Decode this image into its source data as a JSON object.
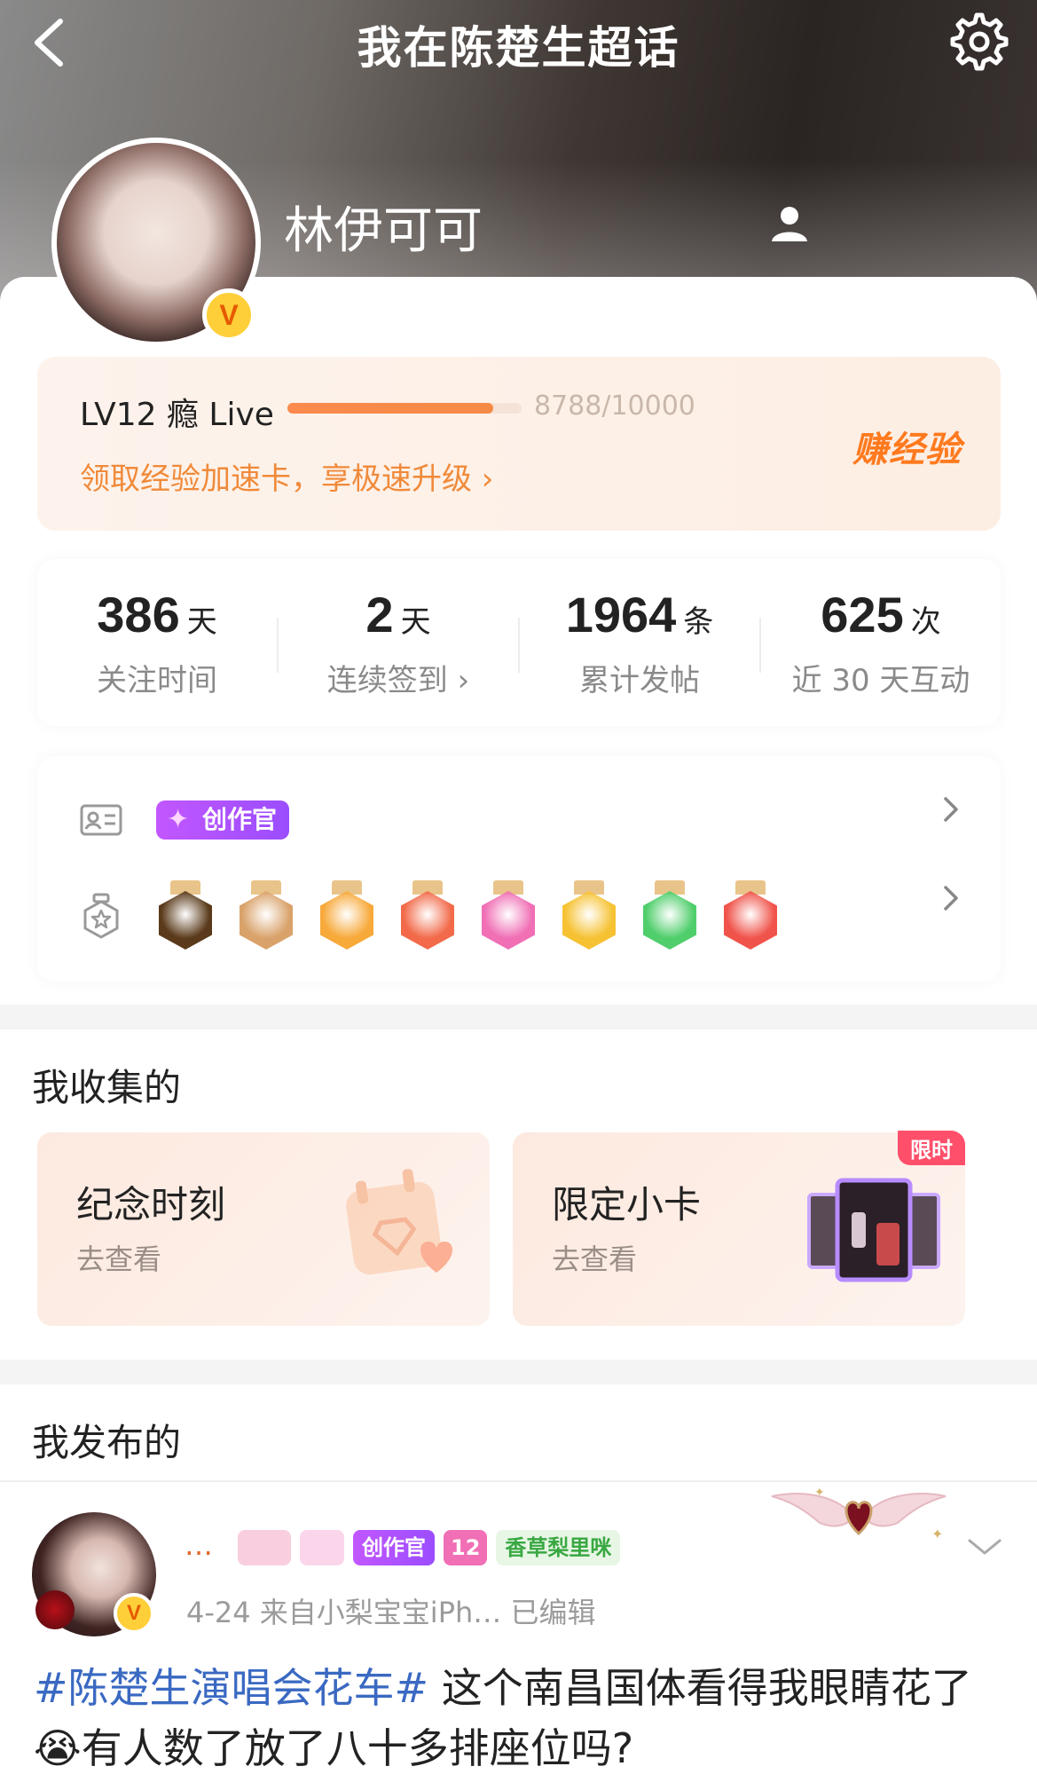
{
  "header": {
    "title": "我在陈楚生超话",
    "username": "林伊可可"
  },
  "level": {
    "name": "LV12 瘾 Live",
    "progress_text": "8788/10000",
    "progress_fraction": 0.8788,
    "link": "领取经验加速卡，享极速升级 ›",
    "earn_button": "赚经验"
  },
  "stats": [
    {
      "value": "386",
      "unit": "天",
      "label": "关注时间"
    },
    {
      "value": "2",
      "unit": "天",
      "label": "连续签到 ›"
    },
    {
      "value": "1964",
      "unit": "条",
      "label": "累计发帖"
    },
    {
      "value": "625",
      "unit": "次",
      "label": "近 30 天互动"
    }
  ],
  "badges": {
    "creator_label": "创作官",
    "medal_colors": [
      "#5a3a1a",
      "#d9a26a",
      "#f7a93a",
      "#f26a4a",
      "#f06fb5",
      "#f6c233",
      "#4fce6b",
      "#f0534a"
    ],
    "medal_names": [
      "super-medal",
      "character-medal",
      "crown-medal",
      "rabbit-medal",
      "lv12-medal",
      "hi-medal",
      "hand-medal",
      "trophy-medal"
    ]
  },
  "collected": {
    "title": "我收集的",
    "cards": [
      {
        "title": "纪念时刻",
        "sub": "去查看"
      },
      {
        "title": "限定小卡",
        "sub": "去查看",
        "tag": "限时"
      }
    ]
  },
  "posted": {
    "title": "我发布的",
    "post": {
      "name": "…",
      "tags": [
        "创作官",
        "12",
        "香草梨里咪"
      ],
      "meta": "4-24  来自小梨宝宝iPh…   已编辑",
      "hashtag": "#陈楚生演唱会花车#",
      "text": " 这个南昌国体看得我眼睛花了😭有人数了放了八十多排座位吗?"
    }
  }
}
